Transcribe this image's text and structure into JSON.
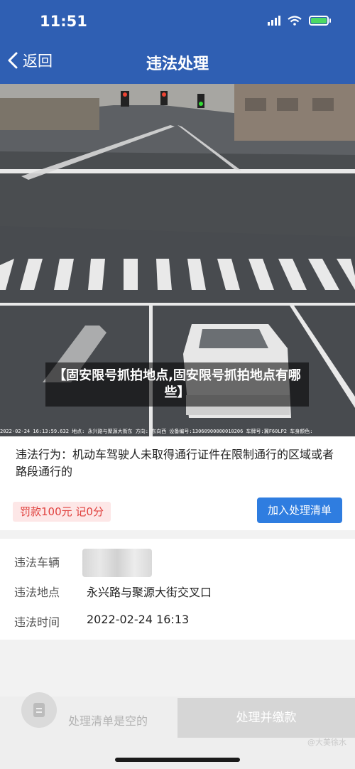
{
  "status_bar": {
    "time": "11:51"
  },
  "nav": {
    "back_label": "返回",
    "title": "违法处理"
  },
  "photo": {
    "overlay_text": "【固安限号抓拍地点,固安限号抓拍地点有哪些】",
    "info_strip": "2022-02-24 16:13:59.632  地点: 永兴路与聚源大街东  方向: 东向西  设备编号:13060900000010206  车牌号:冀F60LP2  车身颜色:"
  },
  "violation": {
    "description": "违法行为：机动车驾驶人未取得通行证件在限制通行的区域或者路段通行的",
    "fine": "罚款100元  记0分",
    "add_button": "加入处理清单"
  },
  "details": {
    "vehicle_label": "违法车辆",
    "location_label": "违法地点",
    "location_value": "永兴路与聚源大街交叉口",
    "time_label": "违法时间",
    "time_value": "2022-02-24 16:13"
  },
  "bottom": {
    "empty_text": "处理清单是空的",
    "pay_button": "处理并缴款",
    "watermark": "@大美徐水"
  },
  "colors": {
    "header": "#2f5fb3",
    "button": "#2f7de0",
    "fine": "#e0403d"
  }
}
